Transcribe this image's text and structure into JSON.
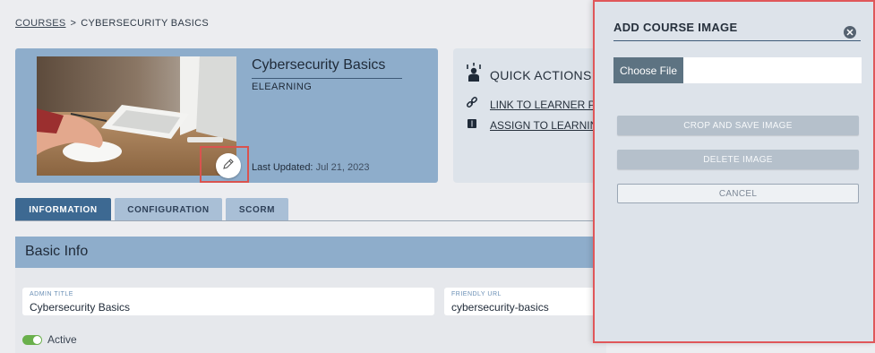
{
  "breadcrumb": {
    "courses_label": "COURSES",
    "separator": ">",
    "current": "CYBERSECURITY BASICS"
  },
  "course": {
    "title": "Cybersecurity Basics",
    "type": "ELEARNING",
    "last_updated_label": "Last Updated: ",
    "last_updated_value": "Jul 21, 2023"
  },
  "quick_actions": {
    "title": "QUICK ACTIONS",
    "links": [
      {
        "label": "LINK TO LEARNER PAGE",
        "icon": "link-icon"
      },
      {
        "label": "ASSIGN TO LEARNING PLAN",
        "icon": "book-icon"
      }
    ]
  },
  "tabs": [
    {
      "label": "INFORMATION",
      "active": true
    },
    {
      "label": "CONFIGURATION",
      "active": false
    },
    {
      "label": "SCORM",
      "active": false
    }
  ],
  "basic_info": {
    "title": "Basic Info",
    "admin_title_label": "ADMIN TITLE",
    "admin_title_value": "Cybersecurity Basics",
    "friendly_url_label": "FRIENDLY URL",
    "friendly_url_value": "cybersecurity-basics",
    "active_label": "Active"
  },
  "modal": {
    "title": "ADD COURSE IMAGE",
    "choose_file_label": "Choose File",
    "crop_save_label": "CROP AND SAVE IMAGE",
    "delete_label": "DELETE IMAGE",
    "cancel_label": "CANCEL"
  },
  "colors": {
    "accent": "#3d6992",
    "card": "#8eadcb",
    "highlight": "#d9534f",
    "toggle_on": "#6ab04c"
  }
}
